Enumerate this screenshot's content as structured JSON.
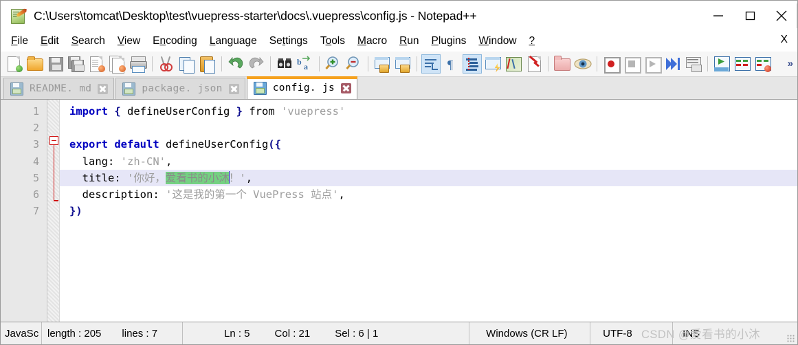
{
  "window": {
    "title": "C:\\Users\\tomcat\\Desktop\\test\\vuepress-starter\\docs\\.vuepress\\config.js - Notepad++",
    "app_icon": "notepad-plus-plus-icon",
    "controls": {
      "minimize": "minimize-icon",
      "maximize": "maximize-icon",
      "close": "close-icon"
    }
  },
  "menubar": {
    "items": [
      {
        "label": "File",
        "mnemonic": "F"
      },
      {
        "label": "Edit",
        "mnemonic": "E"
      },
      {
        "label": "Search",
        "mnemonic": "S"
      },
      {
        "label": "View",
        "mnemonic": "V"
      },
      {
        "label": "Encoding",
        "mnemonic": "n"
      },
      {
        "label": "Language",
        "mnemonic": "L"
      },
      {
        "label": "Settings",
        "mnemonic": "t"
      },
      {
        "label": "Tools",
        "mnemonic": "o"
      },
      {
        "label": "Macro",
        "mnemonic": "M"
      },
      {
        "label": "Run",
        "mnemonic": "R"
      },
      {
        "label": "Plugins",
        "mnemonic": "P"
      },
      {
        "label": "Window",
        "mnemonic": "W"
      },
      {
        "label": "?",
        "mnemonic": "?"
      }
    ],
    "close_document_label": "X"
  },
  "toolbar": {
    "overflow_label": "»",
    "buttons": [
      "new-file-icon",
      "open-file-icon",
      "save-icon",
      "save-all-icon",
      "close-file-icon",
      "close-all-icon",
      "print-icon",
      "sep",
      "cut-icon",
      "copy-icon",
      "paste-icon",
      "sep",
      "undo-icon",
      "redo-icon",
      "sep",
      "find-icon",
      "replace-icon",
      "sep",
      "zoom-in-icon",
      "zoom-out-icon",
      "sep",
      "sync-vertical-scroll-icon",
      "sync-horizontal-scroll-icon",
      "sep",
      "word-wrap-icon",
      "show-all-characters-icon",
      "indent-guideline-icon",
      "user-defined-language-icon",
      "document-map-icon",
      "function-list-icon",
      "sep",
      "folder-as-workspace-icon",
      "monitoring-icon",
      "sep",
      "record-macro-icon",
      "stop-recording-icon",
      "play-macro-icon",
      "run-macro-multiple-icon",
      "save-macro-icon",
      "sep",
      "run-icon",
      "compare-icon",
      "stop-compare-icon"
    ]
  },
  "tabs": [
    {
      "label": "README. md",
      "active": false,
      "icon": "saved-file-icon",
      "close": "close-tab-icon"
    },
    {
      "label": "package. json",
      "active": false,
      "icon": "saved-file-icon",
      "close": "close-tab-icon"
    },
    {
      "label": "config. js",
      "active": true,
      "icon": "saved-file-icon",
      "close": "close-tab-icon"
    }
  ],
  "editor": {
    "line_numbers": [
      "1",
      "2",
      "3",
      "4",
      "5",
      "6",
      "7"
    ],
    "current_line": 5,
    "fold_marker_line": 3,
    "lines": [
      {
        "n": 1,
        "segments": [
          {
            "t": "import",
            "c": "kw"
          },
          {
            "t": " ",
            "c": "pl"
          },
          {
            "t": "{",
            "c": "br"
          },
          {
            "t": " defineUserConfig ",
            "c": "pl"
          },
          {
            "t": "}",
            "c": "br"
          },
          {
            "t": " from ",
            "c": "pl"
          },
          {
            "t": "'vuepress'",
            "c": "str"
          }
        ]
      },
      {
        "n": 2,
        "segments": []
      },
      {
        "n": 3,
        "segments": [
          {
            "t": "export default",
            "c": "kw"
          },
          {
            "t": " defineUserConfig",
            "c": "pl"
          },
          {
            "t": "({",
            "c": "br"
          }
        ]
      },
      {
        "n": 4,
        "segments": [
          {
            "t": "  lang: ",
            "c": "pl"
          },
          {
            "t": "'zh-CN'",
            "c": "str"
          },
          {
            "t": ",",
            "c": "pl"
          }
        ]
      },
      {
        "n": 5,
        "segments": [
          {
            "t": "  title: ",
            "c": "pl"
          },
          {
            "t": "'你好，",
            "c": "str"
          },
          {
            "t": "爱看书的小沐",
            "c": "sel"
          },
          {
            "t": "！'",
            "c": "str"
          },
          {
            "t": ",",
            "c": "pl"
          }
        ]
      },
      {
        "n": 6,
        "segments": [
          {
            "t": "  description: ",
            "c": "pl"
          },
          {
            "t": "'这是我的第一个 VuePress 站点'",
            "c": "str"
          },
          {
            "t": ",",
            "c": "pl"
          }
        ]
      },
      {
        "n": 7,
        "segments": [
          {
            "t": "})",
            "c": "br"
          }
        ]
      }
    ]
  },
  "statusbar": {
    "language": "JavaSc",
    "length_label": "length : 205",
    "lines_label": "lines : 7",
    "ln": "Ln : 5",
    "col": "Col : 21",
    "sel": "Sel : 6 | 1",
    "eol": "Windows (CR LF)",
    "encoding": "UTF-8",
    "insert_mode": "INS"
  },
  "watermark": "CSDN @爱看书的小沐",
  "colors": {
    "accent_orange": "#f5a11e",
    "selection_green": "#74d182",
    "current_line": "#e6e6f7",
    "keyword_blue": "#0000c0",
    "string_gray": "#9e9e9e",
    "fold_red": "#d01212"
  }
}
